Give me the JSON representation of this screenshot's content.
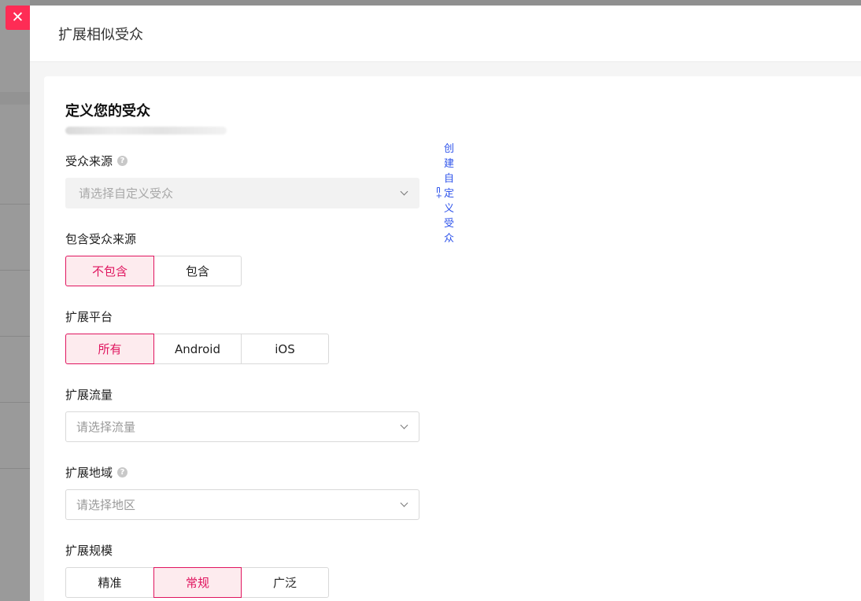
{
  "drawer": {
    "title": "扩展相似受众",
    "close_icon": "close-icon"
  },
  "card": {
    "title": "定义您的受众"
  },
  "audience_source": {
    "label": "受众来源",
    "placeholder": "请选择自定义受众",
    "create_link": "创建自定义受众"
  },
  "include_source": {
    "label": "包含受众来源",
    "options": [
      "不包含",
      "包含"
    ],
    "selected": "不包含"
  },
  "platform": {
    "label": "扩展平台",
    "options": [
      "所有",
      "Android",
      "iOS"
    ],
    "selected": "所有"
  },
  "traffic": {
    "label": "扩展流量",
    "placeholder": "请选择流量"
  },
  "region": {
    "label": "扩展地域",
    "placeholder": "请选择地区"
  },
  "scale": {
    "label": "扩展规模",
    "options": [
      "精准",
      "常规",
      "广泛"
    ],
    "selected": "常规"
  },
  "colors": {
    "accent": "#e0155f",
    "close_bg": "#fe2c55",
    "link": "#2f54eb"
  }
}
